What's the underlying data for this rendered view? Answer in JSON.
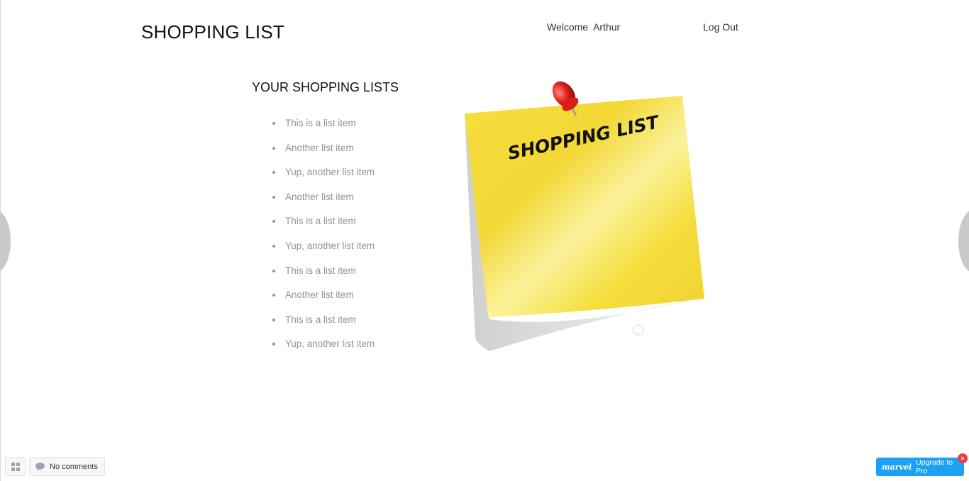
{
  "header": {
    "title": "SHOPPING LIST",
    "welcome_label": "Welcome",
    "username": "Arthur",
    "logout_label": "Log Out"
  },
  "main": {
    "heading": "YOUR SHOPPING LISTS",
    "items": [
      "This is a list item",
      "Another list item",
      "Yup, another list item",
      "Another list item",
      "This is a list item",
      "Yup, another list item",
      "This is a list item",
      "Another list item",
      "This is a list item",
      "Yup, another list item"
    ],
    "note_image": {
      "text": "SHOPPING LIST",
      "icon": "pushpin-icon"
    }
  },
  "footer": {
    "comments_label": "No comments",
    "grid_icon": "grid-icon",
    "comment_icon": "comment-bubble-icon"
  },
  "promo": {
    "brand": "marvel",
    "label": "Upgrade to Pro",
    "close_glyph": "×"
  },
  "colors": {
    "list_text": "#8a93a0",
    "note_yellow": "#f7e34a",
    "promo_blue": "#1da1f2",
    "close_red": "#ef3b3b"
  }
}
